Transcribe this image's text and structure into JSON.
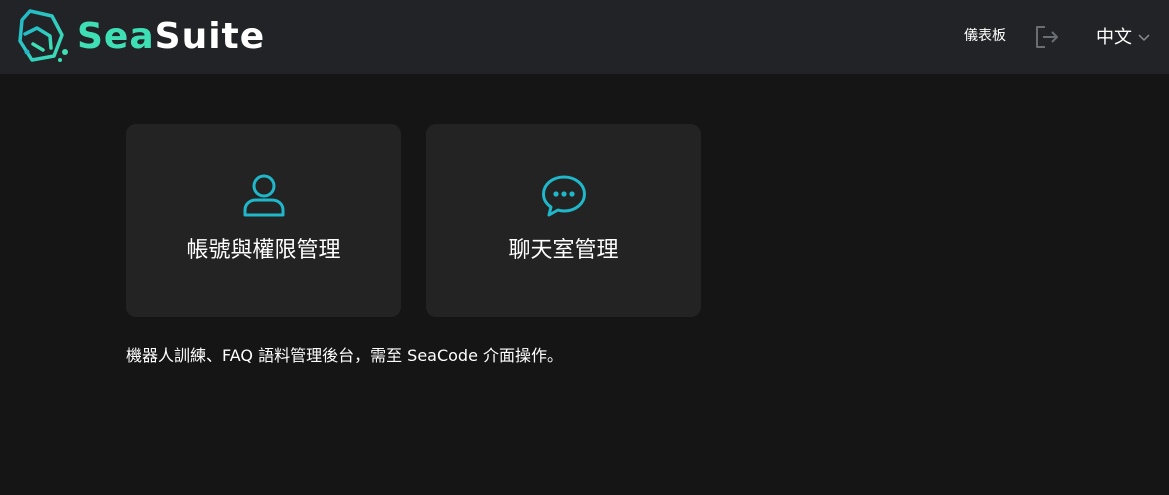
{
  "header": {
    "logo": {
      "sea": "Sea",
      "suite": "Suite"
    },
    "nav_dashboard": "儀表板",
    "logout_icon": "logout-icon",
    "language": {
      "selected": "中文",
      "icon": "chevron-down-icon"
    }
  },
  "cards": [
    {
      "label": "帳號與權限管理",
      "icon": "user-icon"
    },
    {
      "label": "聊天室管理",
      "icon": "chat-bubble-icon"
    }
  ],
  "note": "機器人訓練、FAQ 語料管理後台，需至 SeaCode 介面操作。",
  "colors": {
    "background": "#151515",
    "header": "#222326",
    "card": "#232323",
    "accent_teal": "#1fb7c9",
    "brand_green": "#3fdfb5"
  }
}
